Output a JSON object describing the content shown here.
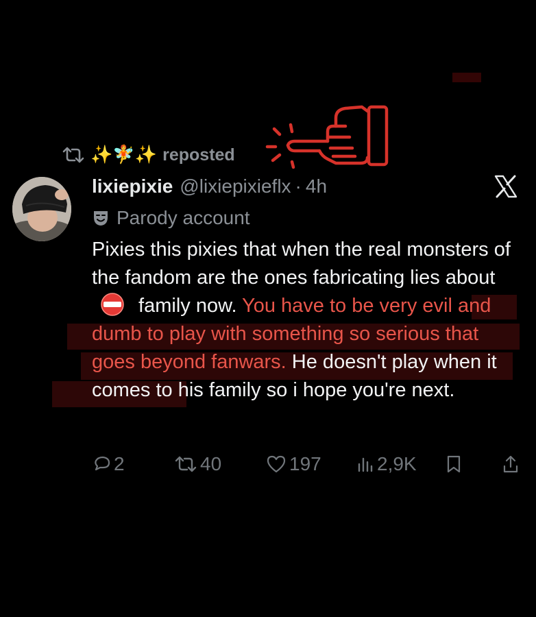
{
  "repost": {
    "emoji": "✨🧚✨",
    "label": "reposted"
  },
  "tweet": {
    "display_name": "lixiepixie",
    "handle": "@lixiepixieflx",
    "separator": "·",
    "time": "4h",
    "parody_label": "Parody account",
    "body_part1": "Pixies this pixies that when the real monsters of the fandom are the ones fabricating lies about ",
    "body_part2": " family now. ",
    "body_red": "You have to be very evil and dumb to play with something so serious that goes beyond fanwars.",
    "body_part3": " He doesn't play when it comes to his family so i hope you're next."
  },
  "actions": {
    "replies": "2",
    "reposts": "40",
    "likes": "197",
    "views": "2,9K"
  },
  "colors": {
    "background": "#000000",
    "text": "#e7e9ea",
    "muted": "#71767b",
    "highlight_text": "#e8554a",
    "annotation": "#d6322a"
  },
  "icons": [
    "repost-icon",
    "fairy-emoji",
    "pointing-hand-icon",
    "x-logo-icon",
    "parody-mask-icon",
    "no-entry-icon",
    "reply-icon",
    "like-icon",
    "views-icon",
    "bookmark-icon",
    "share-icon"
  ]
}
